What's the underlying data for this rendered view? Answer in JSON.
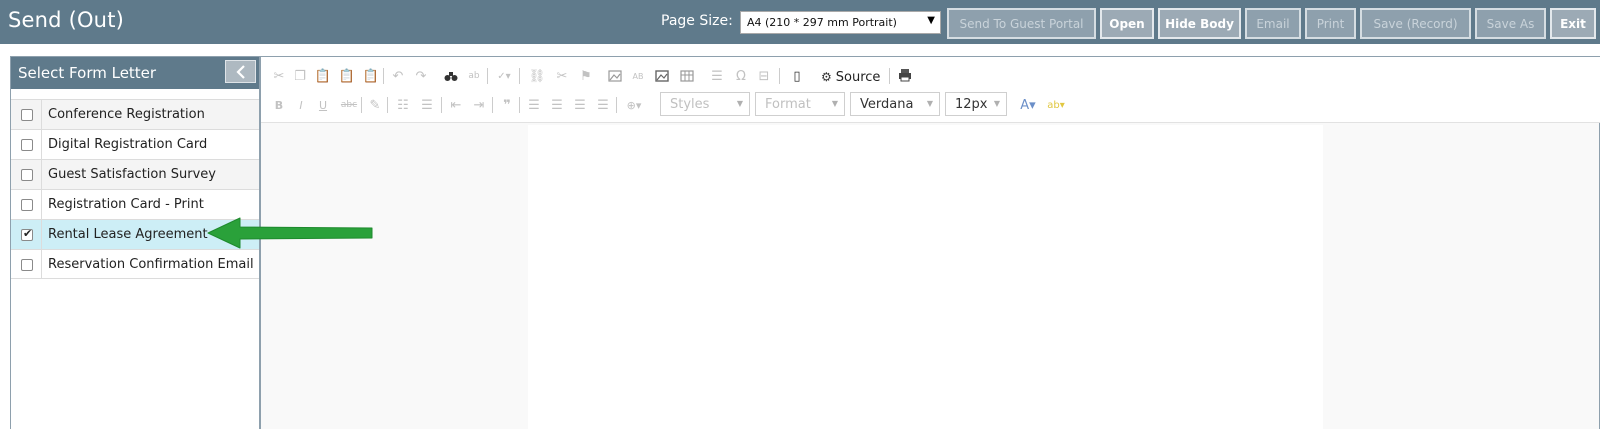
{
  "header": {
    "title": "Send (Out)",
    "page_size_label": "Page Size:",
    "page_size_value": "A4 (210 * 297 mm Portrait)",
    "buttons": {
      "send_to_guest_portal": "Send To Guest Portal",
      "open": "Open",
      "hide_body": "Hide Body",
      "email": "Email",
      "print": "Print",
      "save_record": "Save (Record)",
      "save_as": "Save As",
      "exit": "Exit"
    }
  },
  "form_letters": {
    "title": "Select Form Letter",
    "items": [
      {
        "label": "Conference Registration",
        "checked": false
      },
      {
        "label": "Digital Registration Card",
        "checked": false
      },
      {
        "label": "Guest Satisfaction Survey",
        "checked": false
      },
      {
        "label": "Registration Card - Print",
        "checked": false
      },
      {
        "label": "Rental Lease Agreement",
        "checked": true
      },
      {
        "label": "Reservation Confirmation Email",
        "checked": false
      }
    ]
  },
  "editor": {
    "source_label": "Source",
    "styles_label": "Styles",
    "format_label": "Format",
    "font_value": "Verdana",
    "size_value": "12px"
  },
  "colors": {
    "header_bg": "#5f7a8b",
    "selected_row": "#cdeef6",
    "arrow": "#2aa13a"
  }
}
